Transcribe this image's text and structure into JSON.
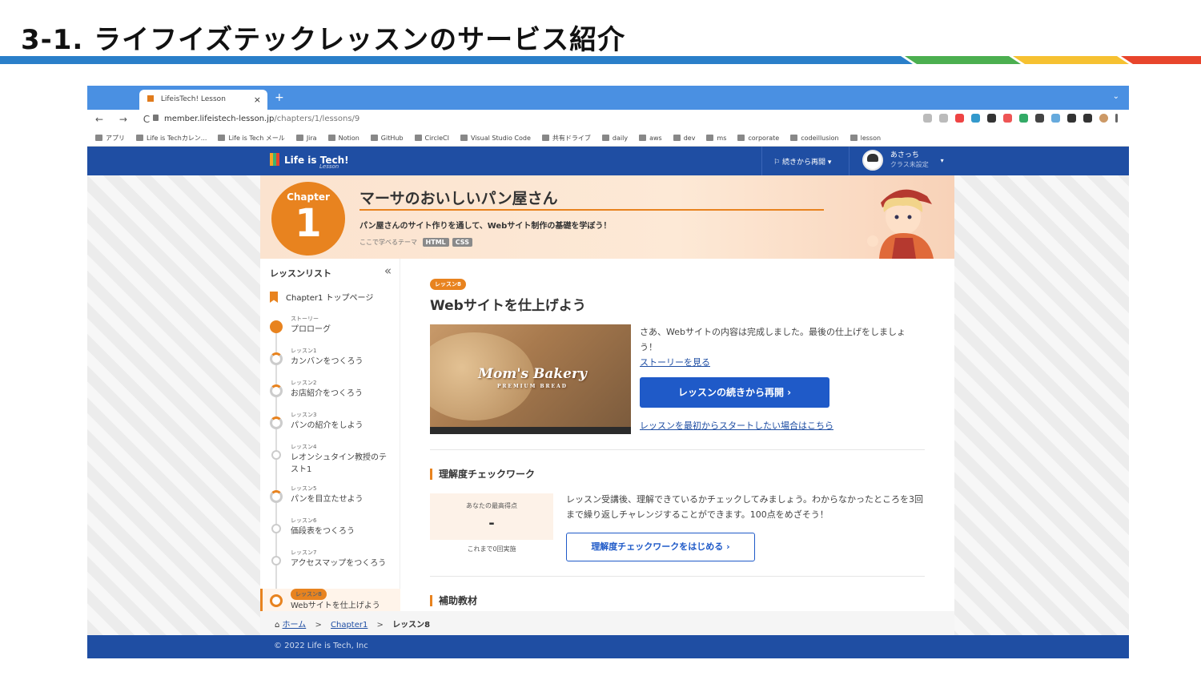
{
  "slide": {
    "title": "3-1. ライフイズテックレッスンのサービス紹介",
    "stripe_colors": [
      "#2a7fc9",
      "#4caf50",
      "#f6c131",
      "#e8452c"
    ]
  },
  "browser": {
    "tab_title": "LifeisTech! Lesson",
    "tab_close": "×",
    "new_tab": "+",
    "url_host": "member.lifeistech-lesson.jp",
    "url_path": "/chapters/1/lessons/9",
    "nav": "← → C",
    "bookmarks": [
      "アプリ",
      "Life is Techカレン...",
      "Life is Tech メール",
      "Jira",
      "Notion",
      "GitHub",
      "CircleCI",
      "Visual Studio Code",
      "共有ドライブ",
      "daily",
      "aws",
      "dev",
      "ms",
      "corporate",
      "codeillusion",
      "lesson"
    ]
  },
  "site": {
    "logo": "Life is Tech!",
    "logo_sub": "Lesson",
    "resume_menu": "続きから再開",
    "user_name": "あさっち",
    "user_class": "クラス未設定",
    "caret": "▾"
  },
  "hero": {
    "chapter_label": "Chapter",
    "chapter_number": "1",
    "title": "マーサのおいしいパン屋さん",
    "subtitle": "パン屋さんのサイト作りを通して、Webサイト制作の基礎を学ぼう！",
    "theme_label": "ここで学べるテーマ",
    "tags": [
      "HTML",
      "CSS"
    ]
  },
  "sidebar": {
    "heading": "レッスンリスト",
    "collapse": "«",
    "top_page": "Chapter1 トップページ",
    "lessons": [
      {
        "small": "ストーリー",
        "name": "プロローグ",
        "state": "done"
      },
      {
        "small": "レッスン1",
        "name": "カンバンをつくろう",
        "state": "half"
      },
      {
        "small": "レッスン2",
        "name": "お店紹介をつくろう",
        "state": "half"
      },
      {
        "small": "レッスン3",
        "name": "パンの紹介をしよう",
        "state": "half"
      },
      {
        "small": "レッスン4",
        "name": "レオンシュタイン教授のテスト1",
        "state": "empty"
      },
      {
        "small": "レッスン5",
        "name": "パンを目立たせよう",
        "state": "half"
      },
      {
        "small": "レッスン6",
        "name": "価段表をつくろう",
        "state": "empty"
      },
      {
        "small": "レッスン7",
        "name": "アクセスマップをつくろう",
        "state": "empty"
      },
      {
        "small": "レッスン8",
        "name": "Webサイトを仕上げよう",
        "state": "current"
      }
    ]
  },
  "main": {
    "lesson_pill": "レッスン8",
    "title": "Webサイトを仕上げよう",
    "thumb_brand": "Mom's Bakery",
    "thumb_brand_sub": "PREMIUM BREAD",
    "intro": "さあ、Webサイトの内容は完成しました。最後の仕上げをしましょう！",
    "story_link": "ストーリーを見る",
    "resume_button": "レッスンの続きから再開 ›",
    "restart_link": "レッスンを最初からスタートしたい場合はこちら",
    "check_title": "理解度チェックワーク",
    "best_score_label": "あなたの最高得点",
    "best_score_value": "-",
    "attempts": "これまで0回実施",
    "check_desc": "レッスン受講後、理解できているかチェックしてみましょう。わからなかったところを3回まで繰り返しチャレンジすることができます。100点をめざそう！",
    "check_button": "理解度チェックワークをはじめる ›",
    "supplement_title": "補助教材"
  },
  "breadcrumb": {
    "home": "ホーム",
    "chapter": "Chapter1",
    "current": "レッスン8",
    "sep": ">"
  },
  "footer": {
    "copyright": "© 2022 Life is Tech, Inc"
  }
}
